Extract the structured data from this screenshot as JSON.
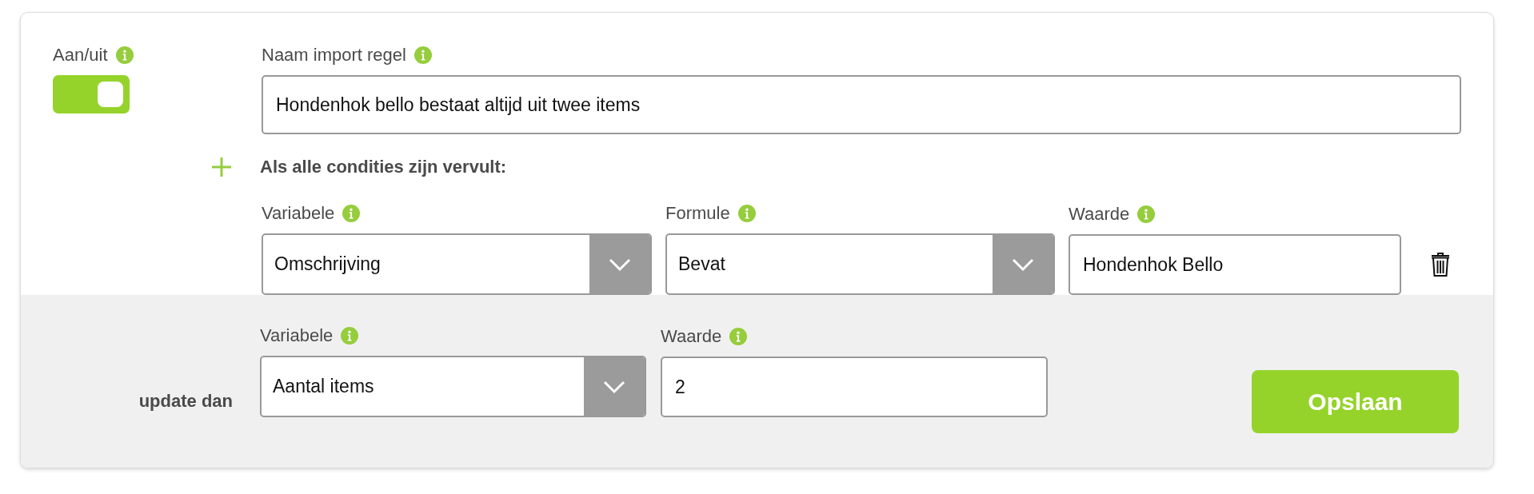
{
  "toggle": {
    "label": "Aan/uit",
    "on": true
  },
  "name_field": {
    "label": "Naam import regel",
    "value": "Hondenhok bello bestaat altijd uit twee items"
  },
  "conditions": {
    "heading": "Als alle condities zijn vervult:",
    "rows": [
      {
        "fields": [
          {
            "kind": "select",
            "label": "Variabele",
            "value": "Omschrijving"
          },
          {
            "kind": "select",
            "label": "Formule",
            "value": "Bevat"
          },
          {
            "kind": "input",
            "label": "Waarde",
            "value": "Hondenhok Bello"
          }
        ]
      }
    ]
  },
  "update": {
    "label": "update dan",
    "fields": [
      {
        "kind": "select",
        "label": "Variabele",
        "value": "Aantal items"
      },
      {
        "kind": "input",
        "label": "Waarde",
        "value": "2"
      }
    ]
  },
  "buttons": [
    {
      "label": "Opslaan"
    }
  ]
}
